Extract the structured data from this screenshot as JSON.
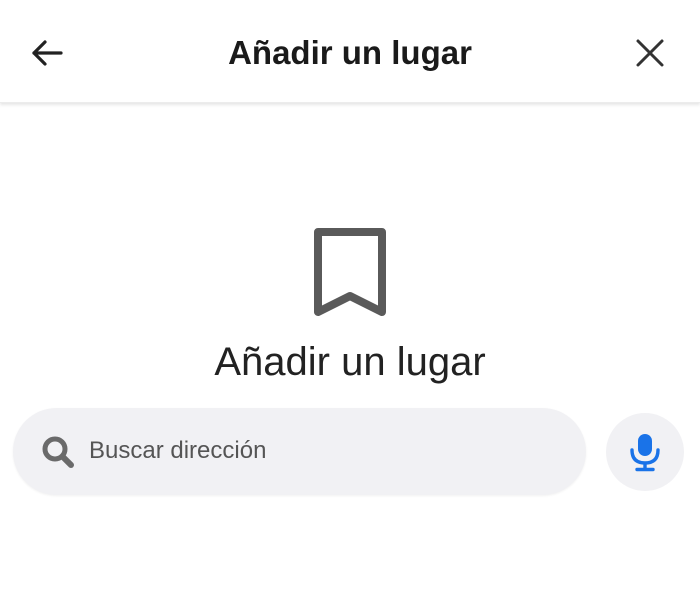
{
  "header": {
    "title": "Añadir un lugar",
    "back_icon": "arrow-left-icon",
    "close_icon": "close-icon"
  },
  "empty_state": {
    "icon": "bookmark-icon",
    "title": "Añadir un lugar"
  },
  "search": {
    "value": "",
    "placeholder": "Buscar dirección",
    "icon": "search-icon"
  },
  "voice": {
    "icon": "microphone-icon"
  },
  "colors": {
    "accent": "#1a73e8",
    "icon_gray": "#555555",
    "field_bg": "#f1f1f4",
    "text": "#222222"
  }
}
